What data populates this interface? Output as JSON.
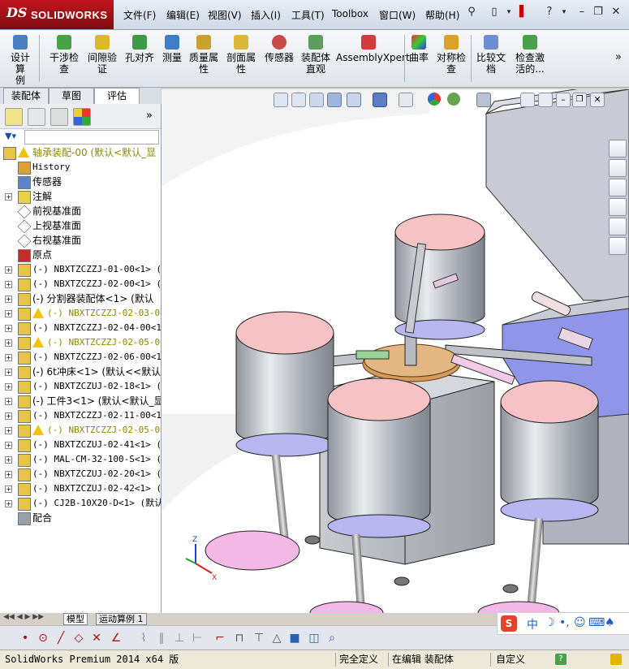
{
  "app": {
    "logo_prefix": "DS",
    "logo_name": "SOLIDWORKS"
  },
  "menu": [
    "文件(F)",
    "编辑(E)",
    "视图(V)",
    "插入(I)",
    "工具(T)",
    "Toolbox",
    "窗口(W)",
    "帮助(H)"
  ],
  "commands": [
    {
      "label": "设计算例",
      "lines": [
        "设计算",
        "例"
      ]
    },
    {
      "label": "干涉检查",
      "lines": [
        "干涉检",
        "查"
      ]
    },
    {
      "label": "间隙验证",
      "lines": [
        "间隙验",
        "证"
      ]
    },
    {
      "label": "孔对齐",
      "lines": [
        "孔对齐"
      ]
    },
    {
      "label": "测量",
      "lines": [
        "测量"
      ]
    },
    {
      "label": "质量属性",
      "lines": [
        "质量属",
        "性"
      ]
    },
    {
      "label": "剖面属性",
      "lines": [
        "剖面属",
        "性"
      ]
    },
    {
      "label": "传感器",
      "lines": [
        "传感器"
      ]
    },
    {
      "label": "装配体直观",
      "lines": [
        "装配体",
        "直观"
      ]
    },
    {
      "label": "AssemblyXpert",
      "lines": [
        "AssemblyXpert"
      ]
    },
    {
      "label": "曲率",
      "lines": [
        "曲率"
      ]
    },
    {
      "label": "对称检查",
      "lines": [
        "对称检",
        "查"
      ]
    },
    {
      "label": "比较文档",
      "lines": [
        "比较文",
        "档"
      ]
    },
    {
      "label": "检查激活的...",
      "lines": [
        "检查激",
        "活的..."
      ]
    }
  ],
  "tabs": [
    "装配体",
    "草图",
    "评估"
  ],
  "active_tab": "评估",
  "tree": [
    {
      "text": "轴承装配-00  (默认<默认_显",
      "icon": "assembly",
      "warn": true,
      "exp": false,
      "indent": 0
    },
    {
      "text": "History",
      "icon": "history",
      "exp": false,
      "indent": 1,
      "mono": true
    },
    {
      "text": "传感器",
      "icon": "sensor",
      "exp": false,
      "indent": 1
    },
    {
      "text": "注解",
      "icon": "annotation",
      "exp": true,
      "indent": 1
    },
    {
      "text": "前视基准面",
      "icon": "plane",
      "exp": false,
      "indent": 1
    },
    {
      "text": "上视基准面",
      "icon": "plane",
      "exp": false,
      "indent": 1
    },
    {
      "text": "右视基准面",
      "icon": "plane",
      "exp": false,
      "indent": 1
    },
    {
      "text": "原点",
      "icon": "origin",
      "exp": false,
      "indent": 1
    },
    {
      "text": "(-) NBXTZCZZJ-01-00<1> (默",
      "icon": "assembly",
      "exp": true,
      "indent": 1,
      "mono": true
    },
    {
      "text": "(-) NBXTZCZZJ-02-00<1> (默",
      "icon": "assembly",
      "exp": true,
      "indent": 1,
      "mono": true
    },
    {
      "text": "(-) 分割器装配体<1> (默认",
      "icon": "assembly",
      "exp": true,
      "indent": 1
    },
    {
      "text": "(-) NBXTZCZZJ-02-03-00<",
      "icon": "assembly",
      "warn": true,
      "exp": true,
      "indent": 1,
      "mono": true
    },
    {
      "text": "(-) NBXTZCZZJ-02-04-00<1>",
      "icon": "assembly",
      "exp": true,
      "indent": 1,
      "mono": true
    },
    {
      "text": "(-) NBXTZCZZJ-02-05-00<",
      "icon": "assembly",
      "warn": true,
      "exp": true,
      "indent": 1,
      "mono": true
    },
    {
      "text": "(-) NBXTZCZZJ-02-06-00<1>",
      "icon": "assembly",
      "exp": true,
      "indent": 1,
      "mono": true
    },
    {
      "text": "(-) 6t冲床<1> (默认<<默认",
      "icon": "assembly",
      "exp": true,
      "indent": 1
    },
    {
      "text": "(-) NBXTZCZUJ-02-18<1> (",
      "icon": "assembly",
      "exp": true,
      "indent": 1,
      "mono": true
    },
    {
      "text": "(-) 工件3<1> (默认<默认_显",
      "icon": "part",
      "exp": true,
      "indent": 1
    },
    {
      "text": "(-) NBXTZCZZJ-02-11-00<1>",
      "icon": "assembly",
      "exp": true,
      "indent": 1,
      "mono": true
    },
    {
      "text": "(-) NBXTZCZZJ-02-05-00<",
      "icon": "assembly",
      "warn": true,
      "exp": true,
      "indent": 1,
      "mono": true
    },
    {
      "text": "(-) NBXTZCZUJ-02-41<1> (",
      "icon": "assembly",
      "exp": true,
      "indent": 1,
      "mono": true
    },
    {
      "text": "(-) MAL-CM-32-100-S<1> (",
      "icon": "assembly",
      "exp": true,
      "indent": 1,
      "mono": true
    },
    {
      "text": "(-) NBXTZCZUJ-02-20<1> (",
      "icon": "assembly",
      "exp": true,
      "indent": 1,
      "mono": true
    },
    {
      "text": "(-) NBXTZCZUJ-02-42<1> (",
      "icon": "assembly",
      "exp": true,
      "indent": 1,
      "mono": true
    },
    {
      "text": "(-) CJ2B-10X20-D<1> (默认",
      "icon": "assembly",
      "exp": true,
      "indent": 1,
      "mono": true
    },
    {
      "text": "配合",
      "icon": "mates",
      "exp": false,
      "indent": 1
    }
  ],
  "bottom_tabs": [
    "模型",
    "运动算例 1"
  ],
  "status": {
    "version": "SolidWorks Premium 2014 x64 版",
    "defined": "完全定义",
    "editing": "在编辑 装配体",
    "custom": "自定义"
  },
  "ime": {
    "logo": "S",
    "mode": "中"
  },
  "colors": {
    "accent": "#c2161d",
    "cup_pink": "#f7c2c4",
    "base_pink": "#f4b8e6",
    "steel": "#b9bcc4"
  }
}
